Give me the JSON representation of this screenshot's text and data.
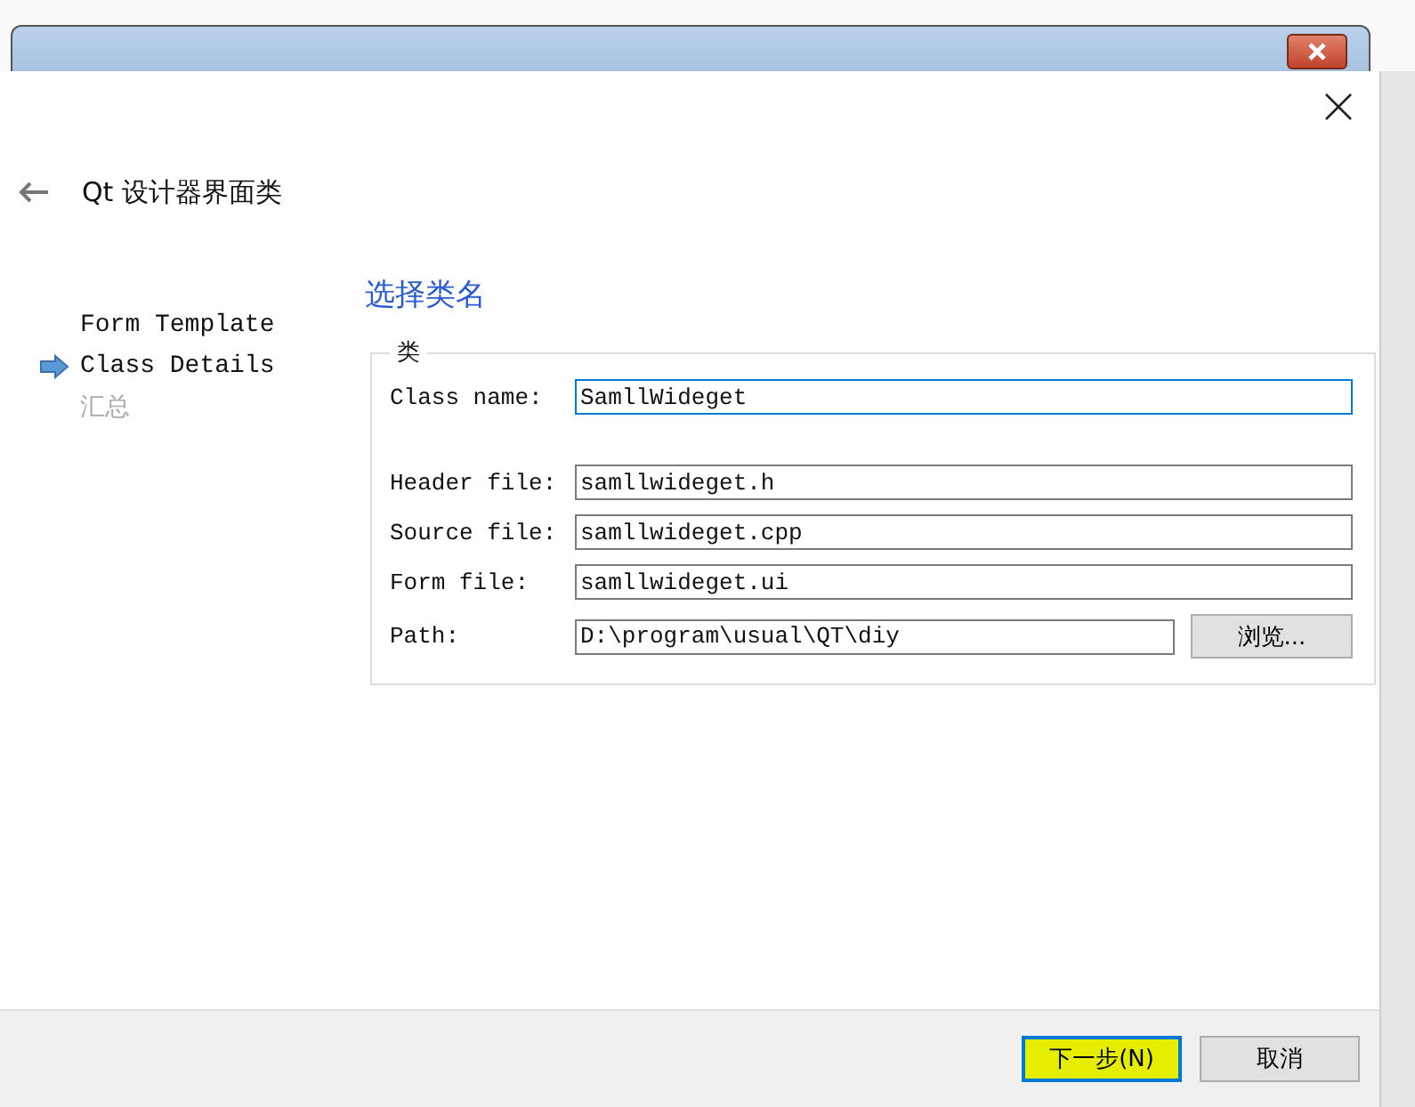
{
  "dialog": {
    "title": "Qt 设计器界面类"
  },
  "steps": [
    {
      "label": "Form Template",
      "selected": false,
      "disabled": false
    },
    {
      "label": "Class Details",
      "selected": true,
      "disabled": false
    },
    {
      "label": "汇总",
      "selected": false,
      "disabled": true
    }
  ],
  "page": {
    "heading": "选择类名",
    "group_title": "类"
  },
  "class_fields": [
    {
      "label": "Class name:",
      "value": "SamllWideget",
      "focused": true
    }
  ],
  "file_fields": [
    {
      "label": "Header file:",
      "value": "samllwideget.h",
      "focused": false
    },
    {
      "label": "Source file:",
      "value": "samllwideget.cpp",
      "focused": false
    },
    {
      "label": "Form file:",
      "value": "samllwideget.ui",
      "focused": false
    },
    {
      "label": "Path:",
      "value": "D:\\program\\usual\\QT\\diy",
      "focused": false,
      "button": "浏览..."
    }
  ],
  "buttons": [
    {
      "label": "下一步(N)",
      "default": true,
      "highlighted": true
    },
    {
      "label": "取消",
      "default": false,
      "highlighted": false
    }
  ]
}
